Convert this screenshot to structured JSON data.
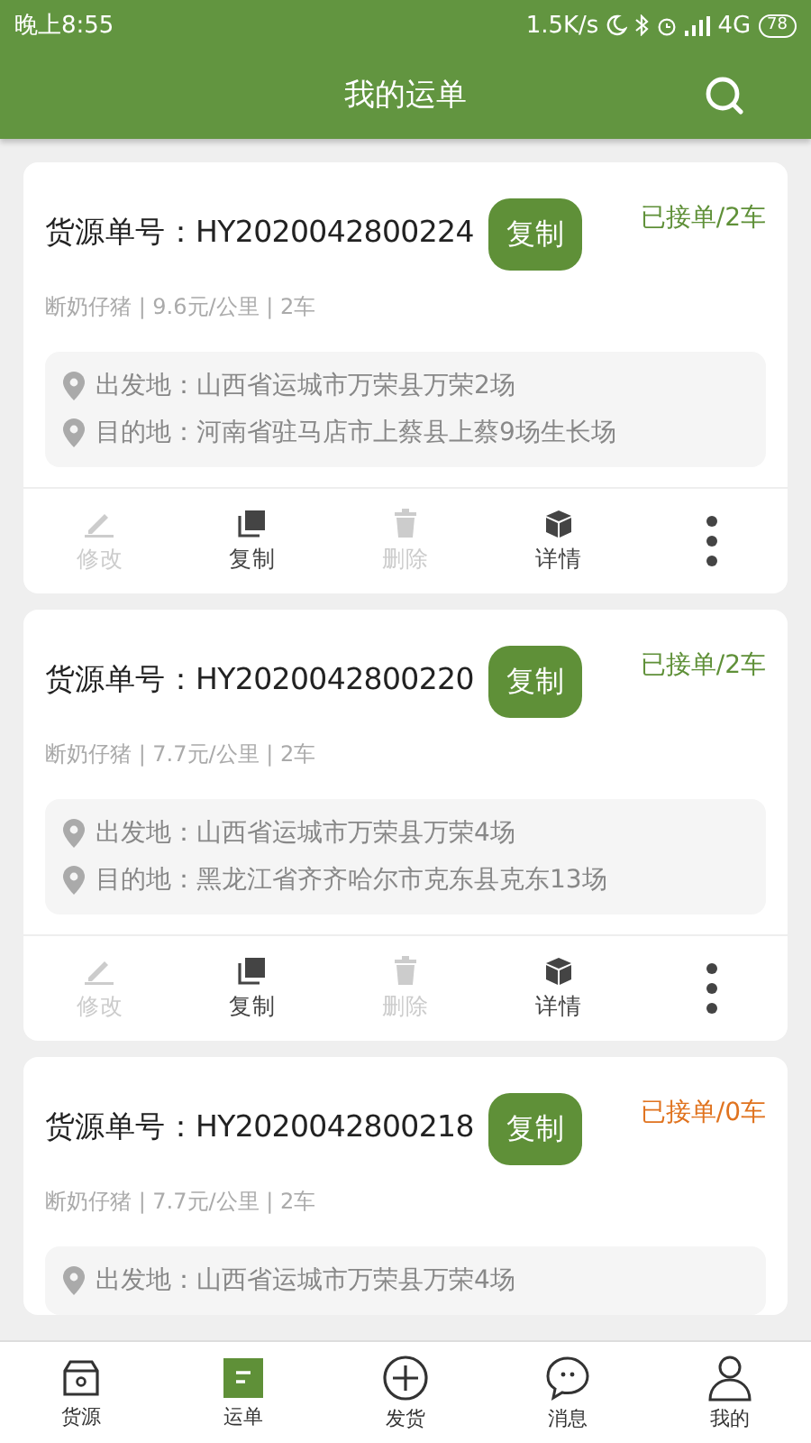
{
  "status_bar": {
    "time": "晚上8:55",
    "speed": "1.5K/s",
    "network": "4G",
    "battery": "78"
  },
  "header": {
    "title": "我的运单"
  },
  "orders": [
    {
      "number_label": "货源单号：",
      "number": "HY2020042800224",
      "copy_button": "复制",
      "status": "已接单/2车",
      "color": "#5f9038",
      "meta": "断奶仔猪 | 9.6元/公里 | 2车",
      "origin": "出发地：山西省运城市万荣县万荣2场",
      "destination": "目的地：河南省驻马店市上蔡县上蔡9场生长场",
      "actions": [
        {
          "kind": "edit",
          "label": "修改",
          "disabled": true
        },
        {
          "kind": "copy",
          "label": "复制",
          "disabled": false
        },
        {
          "kind": "delete",
          "label": "删除",
          "disabled": true
        },
        {
          "kind": "detail",
          "label": "详情",
          "disabled": false
        },
        {
          "kind": "more",
          "disabled": false
        }
      ]
    },
    {
      "number_label": "货源单号：",
      "number": "HY2020042800220",
      "copy_button": "复制",
      "status": "已接单/2车",
      "color": "#5f9038",
      "meta": "断奶仔猪 | 7.7元/公里 | 2车",
      "origin": "出发地：山西省运城市万荣县万荣4场",
      "destination": "目的地：黑龙江省齐齐哈尔市克东县克东13场",
      "actions": [
        {
          "kind": "edit",
          "label": "修改",
          "disabled": true
        },
        {
          "kind": "copy",
          "label": "复制",
          "disabled": false
        },
        {
          "kind": "delete",
          "label": "删除",
          "disabled": true
        },
        {
          "kind": "detail",
          "label": "详情",
          "disabled": false
        },
        {
          "kind": "more",
          "disabled": false
        }
      ]
    },
    {
      "number_label": "货源单号：",
      "number": "HY2020042800218",
      "copy_button": "复制",
      "status": "已接单/0车",
      "color": "#e0731f",
      "meta": "断奶仔猪 | 7.7元/公里 | 2车",
      "origin": "出发地：山西省运城市万荣县万荣4场"
    }
  ],
  "tabs": [
    {
      "kind": "source",
      "label": "货源",
      "selected": false
    },
    {
      "kind": "orders",
      "label": "运单",
      "selected": true
    },
    {
      "kind": "ship",
      "label": "发货",
      "selected": false
    },
    {
      "kind": "messages",
      "label": "消息",
      "selected": false
    },
    {
      "kind": "profile",
      "label": "我的",
      "selected": false
    }
  ]
}
